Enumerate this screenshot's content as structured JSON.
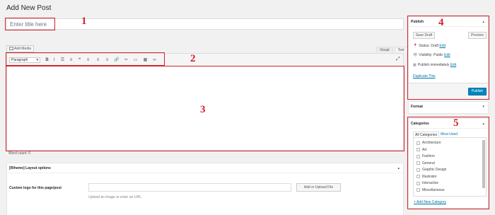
{
  "page": {
    "title": "Add New Post"
  },
  "title_field": {
    "placeholder": "Enter title here"
  },
  "editor": {
    "add_media_label": "Add Media",
    "tabs": [
      "Visual",
      "Text"
    ],
    "format_select": "Paragraph",
    "toolbar_buttons": [
      {
        "name": "bold-icon",
        "glyph": "B"
      },
      {
        "name": "italic-icon",
        "glyph": "I"
      },
      {
        "name": "bulleted-list-icon",
        "glyph": "☰"
      },
      {
        "name": "numbered-list-icon",
        "glyph": "≡"
      },
      {
        "name": "blockquote-icon",
        "glyph": "❝"
      },
      {
        "name": "align-left-icon",
        "glyph": "≡"
      },
      {
        "name": "align-center-icon",
        "glyph": "≡"
      },
      {
        "name": "align-right-icon",
        "glyph": "≡"
      },
      {
        "name": "link-icon",
        "glyph": "🔗"
      },
      {
        "name": "unlink-icon",
        "glyph": "✂"
      },
      {
        "name": "read-more-icon",
        "glyph": "▭"
      },
      {
        "name": "toolbar-toggle-icon",
        "glyph": "▦"
      },
      {
        "name": "plugin-icon",
        "glyph": "∞"
      }
    ],
    "word_count": "Word count: 0"
  },
  "layout_options": {
    "title": "[Rtheme] Layout options",
    "logo_label": "Custom logo for this page/post",
    "upload_button": "Add or Upload File",
    "description": "Upload an image or enter an URL."
  },
  "publish": {
    "title": "Publish",
    "save_draft": "Save Draft",
    "preview": "Preview",
    "status_label": "Status: Draft",
    "visibility_label": "Visibility: Public",
    "schedule_label": "Publish immediately",
    "edit_label": "Edit",
    "duplicate_label": "Duplicate This",
    "publish_button": "Publish"
  },
  "format_box": {
    "title": "Format"
  },
  "categories": {
    "title": "Categories",
    "tab_all": "All Categories",
    "tab_used": "Most Used",
    "items": [
      "Architecture",
      "Art",
      "Fashion",
      "General",
      "Graphic Design",
      "Illustrator",
      "Interactive",
      "Miscellaneous"
    ],
    "add_link": "+ Add New Category"
  },
  "annotations": [
    "1",
    "2",
    "3",
    "4",
    "5"
  ],
  "colors": {
    "annotation_red": "#d2232a",
    "primary_blue": "#0085ba",
    "link_blue": "#0073aa"
  }
}
